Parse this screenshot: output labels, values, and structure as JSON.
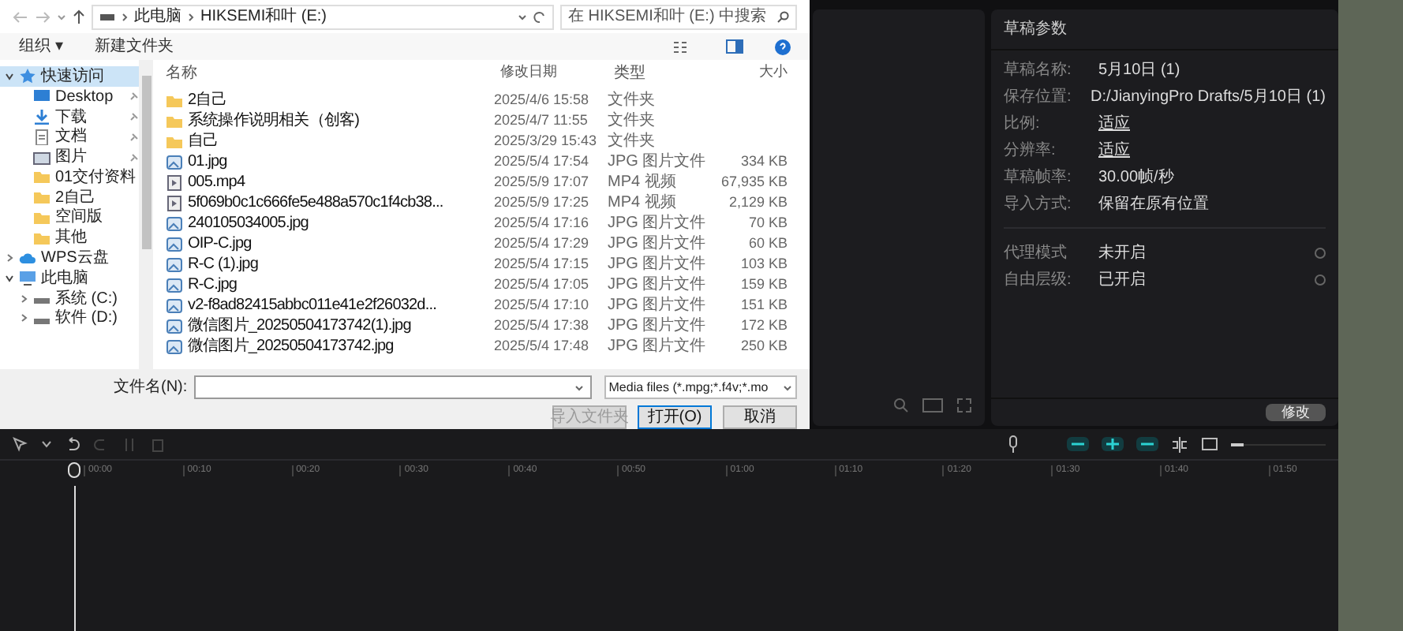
{
  "dialog": {
    "breadcrumb": [
      "此电脑",
      "HIKSEMI和叶 (E:)"
    ],
    "search": {
      "placeholder": "在 HIKSEMI和叶 (E:) 中搜索"
    },
    "toolbar": [
      "组织 ▾",
      "新建文件夹"
    ],
    "sidebar": [
      {
        "label": "快速访问",
        "kind": "star",
        "selected": true,
        "expanded": true,
        "children": [
          {
            "label": "Desktop",
            "kind": "desktop",
            "pinned": true
          },
          {
            "label": "下载",
            "kind": "download",
            "pinned": true
          },
          {
            "label": "文档",
            "kind": "document",
            "pinned": true
          },
          {
            "label": "图片",
            "kind": "picture",
            "pinned": true
          },
          {
            "label": "01交付资料",
            "kind": "folder"
          },
          {
            "label": "2自己",
            "kind": "folder"
          },
          {
            "label": "空间版",
            "kind": "folder"
          },
          {
            "label": "其他",
            "kind": "folder"
          }
        ]
      },
      {
        "label": "WPS云盘",
        "kind": "cloud",
        "selected": false,
        "expanded": false
      },
      {
        "label": "此电脑",
        "kind": "pc",
        "selected": false,
        "expanded": true,
        "children": [
          {
            "label": "系统 (C:)",
            "kind": "drive",
            "expanded": false
          },
          {
            "label": "软件 (D:)",
            "kind": "drive",
            "expanded": false
          }
        ]
      }
    ],
    "columns": [
      "名称",
      "修改日期",
      "类型",
      "大小"
    ],
    "files": [
      {
        "name": "2自己",
        "date": "2025/4/6 15:58",
        "type": "文件夹",
        "kind": "folder"
      },
      {
        "name": "系统操作说明相关（创客)",
        "date": "2025/4/7 11:55",
        "type": "文件夹",
        "kind": "folder"
      },
      {
        "name": "自己",
        "date": "2025/3/29 15:43",
        "type": "文件夹",
        "kind": "folder"
      },
      {
        "name": "01.jpg",
        "date": "2025/5/4 17:54",
        "type": "JPG 图片文件",
        "size": "334 KB",
        "kind": "image"
      },
      {
        "name": "005.mp4",
        "date": "2025/5/9 17:07",
        "type": "MP4 视频",
        "size": "67,935 KB",
        "kind": "video"
      },
      {
        "name": "5f069b0c1c666fe5e488a570c1f4cb38...",
        "date": "2025/5/9 17:25",
        "type": "MP4 视频",
        "size": "2,129 KB",
        "kind": "video"
      },
      {
        "name": "240105034005.jpg",
        "date": "2025/5/4 17:16",
        "type": "JPG 图片文件",
        "size": "70 KB",
        "kind": "image"
      },
      {
        "name": "OIP-C.jpg",
        "date": "2025/5/4 17:29",
        "type": "JPG 图片文件",
        "size": "60 KB",
        "kind": "image"
      },
      {
        "name": "R-C (1).jpg",
        "date": "2025/5/4 17:15",
        "type": "JPG 图片文件",
        "size": "103 KB",
        "kind": "image"
      },
      {
        "name": "R-C.jpg",
        "date": "2025/5/4 17:05",
        "type": "JPG 图片文件",
        "size": "159 KB",
        "kind": "image"
      },
      {
        "name": "v2-f8ad82415abbc011e41e2f26032d...",
        "date": "2025/5/4 17:10",
        "type": "JPG 图片文件",
        "size": "151 KB",
        "kind": "image"
      },
      {
        "name": "微信图片_20250504173742(1).jpg",
        "date": "2025/5/4 17:38",
        "type": "JPG 图片文件",
        "size": "172 KB",
        "kind": "image"
      },
      {
        "name": "微信图片_20250504173742.jpg",
        "date": "2025/5/4 17:48",
        "type": "JPG 图片文件",
        "size": "250 KB",
        "kind": "image"
      }
    ],
    "filename_label": "文件名(N):",
    "filter": "Media files (*.mpg;*.f4v;*.mo",
    "buttons": [
      {
        "label": "导入文件夹",
        "disabled": true,
        "primary": false
      },
      {
        "label": "打开(O)",
        "disabled": false,
        "primary": true
      },
      {
        "label": "取消",
        "disabled": false,
        "primary": false
      }
    ]
  },
  "draft_panel": {
    "title": "草稿参数",
    "rows": [
      {
        "label": "草稿名称:",
        "value": "5月10日 (1)",
        "underlined": false
      },
      {
        "label": "保存位置:",
        "value": "D:/JianyingPro Drafts/5月10日 (1)",
        "underlined": false
      },
      {
        "label": "比例:",
        "value": "适应",
        "underlined": true
      },
      {
        "label": "分辨率:",
        "value": "适应",
        "underlined": true
      },
      {
        "label": "草稿帧率:",
        "value": "30.00帧/秒",
        "underlined": false
      },
      {
        "label": "导入方式:",
        "value": "保留在原有位置",
        "underlined": false
      }
    ],
    "options": [
      {
        "label": "代理模式",
        "value": "未开启"
      },
      {
        "label": "自由层级:",
        "value": "已开启"
      }
    ],
    "button": "修改"
  },
  "timeline": {
    "ticks": [
      "00:00",
      "00:10",
      "00:20",
      "00:30",
      "00:40",
      "00:50",
      "01:00",
      "01:10",
      "01:20",
      "01:30",
      "01:40",
      "01:50"
    ]
  }
}
